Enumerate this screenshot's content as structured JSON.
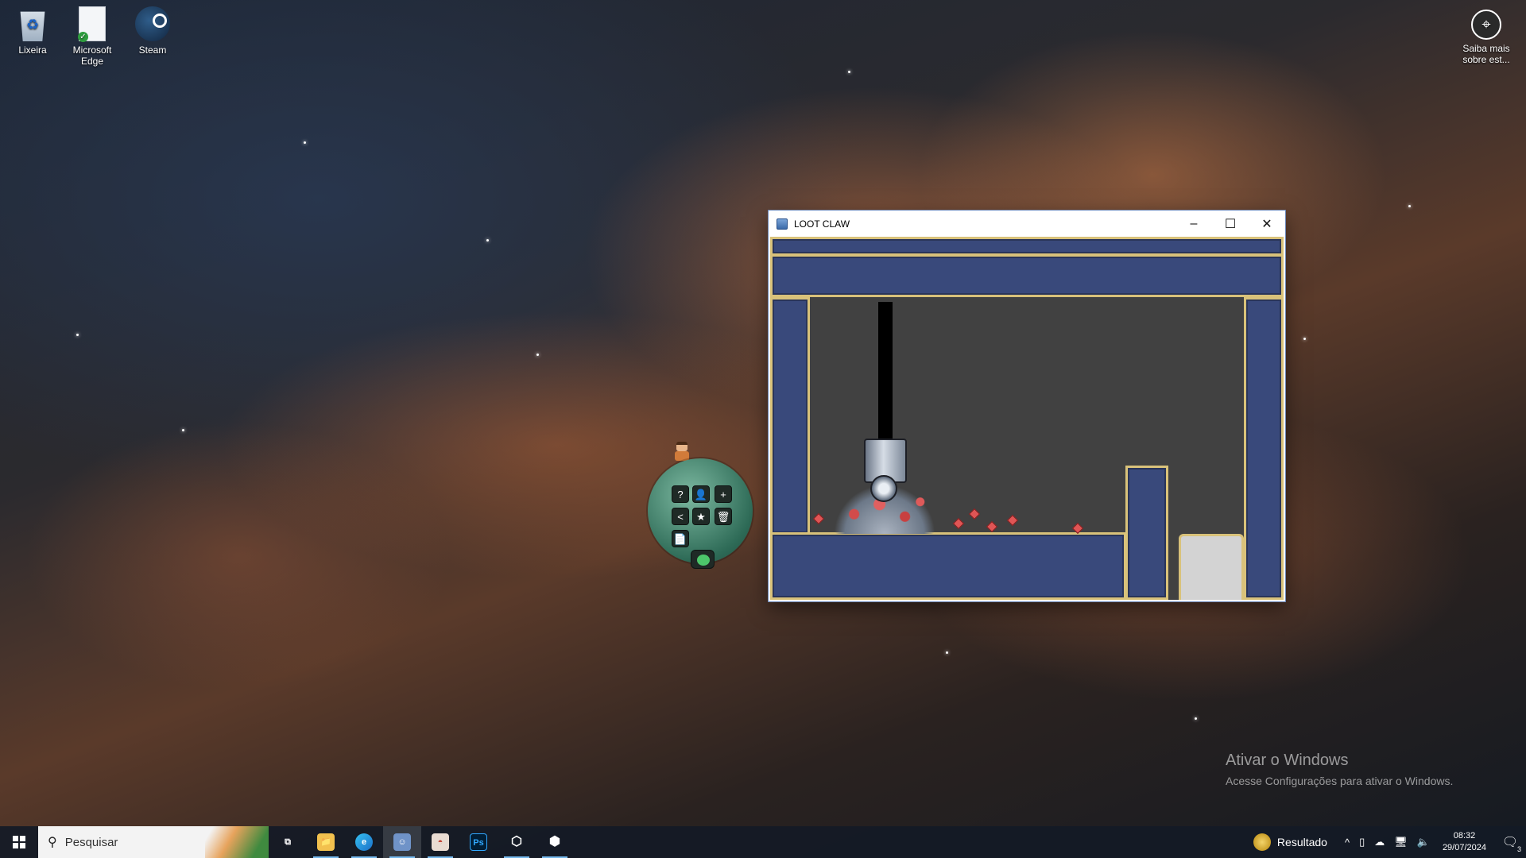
{
  "desktop": {
    "icons": [
      {
        "label": "Lixeira",
        "icon": "recycle-bin-icon"
      },
      {
        "label": "Microsoft Edge",
        "icon": "edge-shortcut-icon"
      },
      {
        "label": "Steam",
        "icon": "steam-icon"
      }
    ],
    "right_icon": {
      "label": "Saiba mais sobre est...",
      "icon": "learn-more-icon"
    }
  },
  "window": {
    "title": "LOOT CLAW",
    "minimize_glyph": "–",
    "maximize_glyph": "☐",
    "close_glyph": "✕"
  },
  "mascot": {
    "buttons": [
      "?",
      "👤",
      "+",
      "<",
      "★",
      "🗑",
      "📄"
    ]
  },
  "watermark": {
    "line1": "Ativar o Windows",
    "line2": "Acesse Configurações para ativar o Windows."
  },
  "taskbar": {
    "search_placeholder": "Pesquisar",
    "apps": [
      {
        "icon": "task-view-icon",
        "glyph": "⧉"
      },
      {
        "icon": "file-explorer-icon",
        "glyph": "📁"
      },
      {
        "icon": "edge-icon",
        "glyph": "e"
      },
      {
        "icon": "loot-claw-app-icon",
        "glyph": "☺"
      },
      {
        "icon": "game-app-icon",
        "glyph": "◓"
      },
      {
        "icon": "photoshop-icon",
        "glyph": "Ps"
      },
      {
        "icon": "unity-icon",
        "glyph": "⬡"
      },
      {
        "icon": "unity-hub-icon",
        "glyph": "⬢"
      }
    ],
    "tray": {
      "result_label": "Resultado",
      "chevron": "^",
      "time": "08:32",
      "date": "29/07/2024",
      "notification_count": "3"
    }
  },
  "colors": {
    "game_bg": "#414141",
    "panel_blue": "#39497b",
    "gold_trim": "#d9c27a",
    "taskbar": "#141a26"
  }
}
